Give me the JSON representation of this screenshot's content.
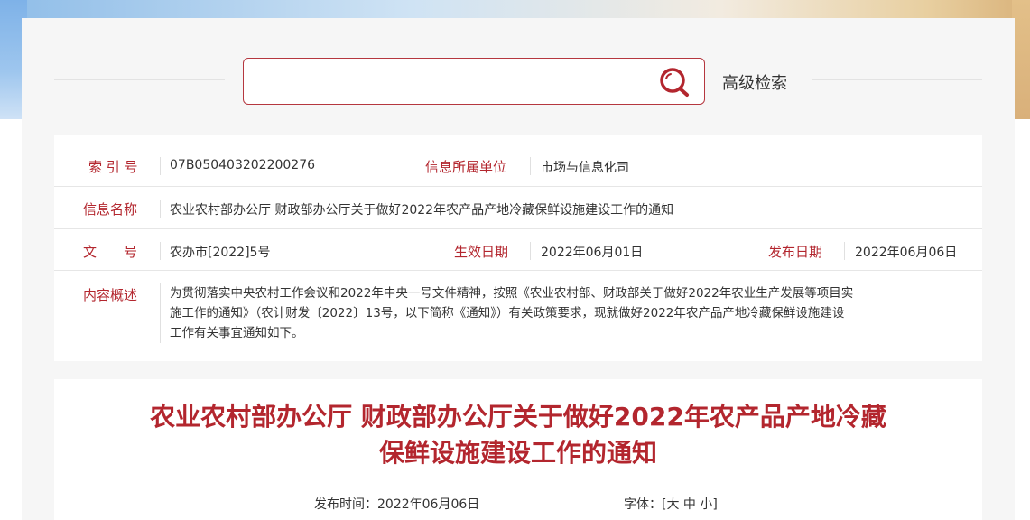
{
  "search": {
    "placeholder": ""
  },
  "advanced_search_label": "高级检索",
  "info": {
    "index_label": "索 引 号",
    "index_value": "07B050403202200276",
    "unit_label": "信息所属单位",
    "unit_value": "市场与信息化司",
    "name_label": "信息名称",
    "name_value": "农业农村部办公厅 财政部办公厅关于做好2022年农产品产地冷藏保鲜设施建设工作的通知",
    "docno_label": "文　　号",
    "docno_value": "农办市[2022]5号",
    "effective_label": "生效日期",
    "effective_value": "2022年06月01日",
    "publish_label": "发布日期",
    "publish_value": "2022年06月06日",
    "summary_label": "内容概述",
    "summary_lines": [
      "为贯彻落实中央农村工作会议和2022年中央一号文件精神，按照《农业农村部、财政部关于做好2022年农业生产发展等项目实",
      "施工作的通知》（农计财发〔2022〕13号，以下简称《通知》）有关政策要求，现就做好2022年农产品产地冷藏保鲜设施建设",
      "工作有关事宜通知如下。"
    ]
  },
  "article": {
    "title_line1": "农业农村部办公厅 财政部办公厅关于做好2022年农产品产地冷藏",
    "title_line2": "保鲜设施建设工作的通知",
    "publish_time": "发布时间：2022年06月06日",
    "font_label": "字体：",
    "font_open": "[",
    "font_large": "大",
    "font_medium": "中",
    "font_small": "小",
    "font_close": "]"
  },
  "colors": {
    "accent": "#b3262e"
  }
}
